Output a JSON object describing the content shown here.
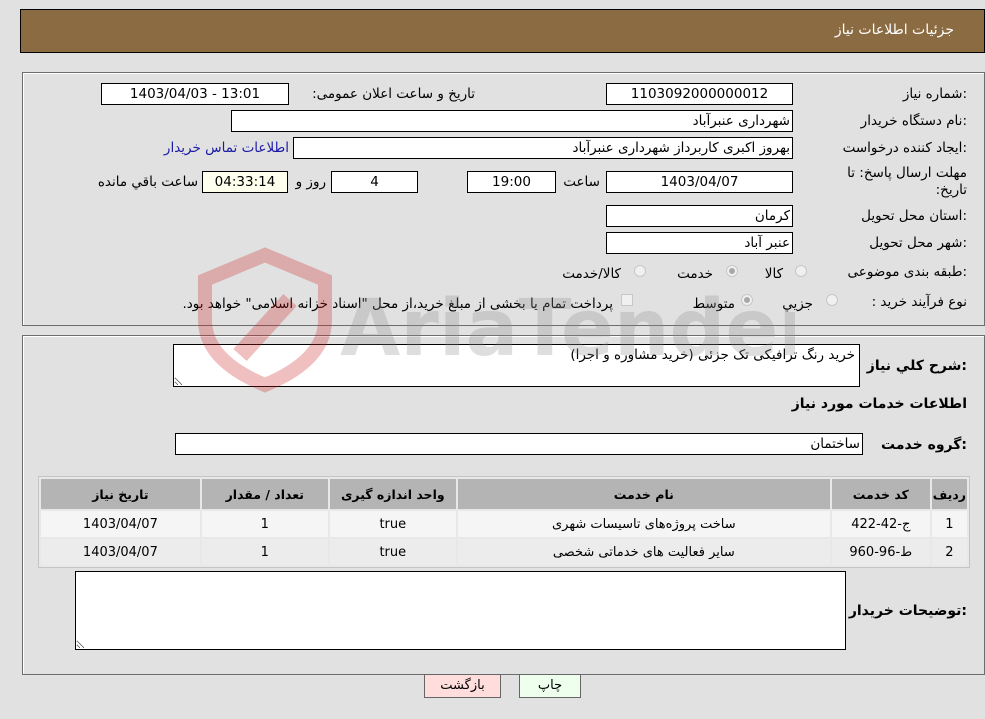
{
  "header": {
    "title": "جزئیات اطلاعات نیاز"
  },
  "details": {
    "need_number_label": "شماره نیاز:",
    "need_number": "1103092000000012",
    "announce_label": "تاریخ و ساعت اعلان عمومی:",
    "announce_value": "1403/04/03 - 13:01",
    "buyer_org_label": "نام دستگاه خریدار:",
    "buyer_org": "شهرداری عنبرآباد",
    "creator_label": "ایجاد کننده درخواست:",
    "creator": "بهروز اکبری کاربرداز شهرداری عنبرآباد",
    "contact_link": "اطلاعات تماس خریدار",
    "deadline_label": "مهلت ارسال پاسخ: تا تاریخ:",
    "deadline_date": "1403/04/07",
    "time_label": "ساعت",
    "deadline_time": "19:00",
    "days": "4",
    "days_label": "روز و",
    "remaining_time": "04:33:14",
    "remaining_label": "ساعت باقي مانده",
    "province_label": "استان محل تحویل:",
    "province": "کرمان",
    "city_label": "شهر محل تحویل:",
    "city": "عنبر آباد",
    "category_label": "طبقه بندی موضوعی:",
    "category_options": [
      "کالا",
      "خدمت",
      "کالا/خدمت"
    ],
    "category_selected": "خدمت",
    "process_label": "نوع فرآیند خرید :",
    "process_options": [
      "جزيي",
      "متوسط"
    ],
    "process_selected": "متوسط",
    "treasury_note": "پرداخت تمام یا بخشی از مبلغ خرید،از محل \"اسناد خزانه اسلامی\" خواهد بود."
  },
  "description": {
    "label": "شرح کلي نياز:",
    "value": "خرید رنگ ترافیکی تک جزئی (خرید مشاوره و اجرا)"
  },
  "services": {
    "section_title": "اطلاعات خدمات مورد نياز",
    "group_label": "گروه خدمت:",
    "group_value": "ساختمان",
    "columns": [
      "رديف",
      "کد خدمت",
      "نام خدمت",
      "واحد اندازه گيری",
      "تعداد / مقدار",
      "تاریخ نیاز"
    ],
    "rows": [
      [
        "1",
        "ج-42-422",
        "ساخت پروژه‌های تاسیسات شهری",
        "true",
        "1",
        "1403/04/07"
      ],
      [
        "2",
        "ط-96-960",
        "سایر فعالیت های خدماتی شخصی",
        "true",
        "1",
        "1403/04/07"
      ]
    ]
  },
  "buyer_notes": {
    "label": "توضیحات خریدار:",
    "value": ""
  },
  "buttons": {
    "print": "چاپ",
    "back": "بازگشت"
  },
  "watermark": {
    "text": "AriaTender.neT"
  }
}
